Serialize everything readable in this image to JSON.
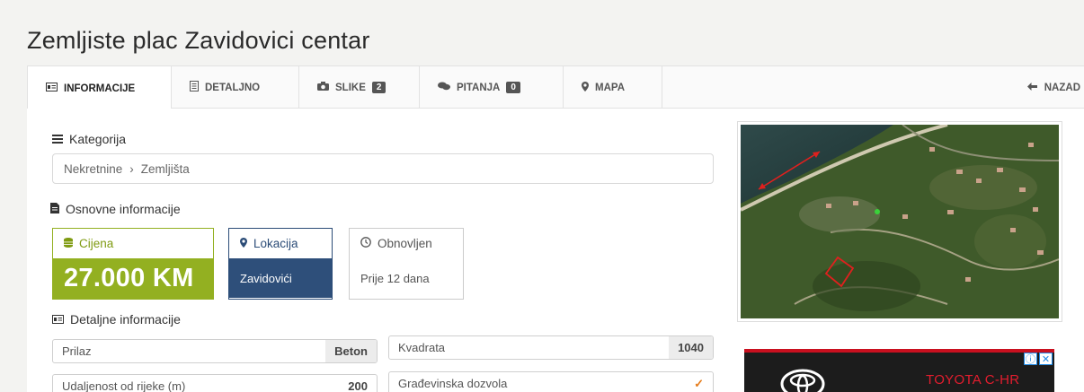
{
  "title": "Zemljiste plac Zavidovici centar",
  "tabs": [
    {
      "label": "INFORMACIJE",
      "icon": "id-card-icon",
      "active": true
    },
    {
      "label": "DETALJNO",
      "icon": "list-icon"
    },
    {
      "label": "SLIKE",
      "icon": "camera-icon",
      "count": "2"
    },
    {
      "label": "PITANJA",
      "icon": "comments-icon",
      "count": "0"
    },
    {
      "label": "MAPA",
      "icon": "map-pin-icon"
    }
  ],
  "back_label": "NAZAD",
  "kategorija": {
    "title": "Kategorija",
    "crumb_1": "Nekretnine",
    "crumb_sep": "›",
    "crumb_2": "Zemljišta"
  },
  "osnovne": {
    "title": "Osnovne informacije",
    "price": {
      "label": "Cijena",
      "value": "27.000 KM"
    },
    "location": {
      "label": "Lokacija",
      "value": "Zavidovići"
    },
    "updated": {
      "label": "Obnovljen",
      "value": "Prije 12 dana"
    }
  },
  "detaljne": {
    "title": "Detaljne informacije",
    "rows": [
      {
        "label": "Prilaz",
        "value": "Beton"
      },
      {
        "label": "Kvadrata",
        "value": "1040"
      },
      {
        "label": "Udaljenost od rijeke (m)",
        "value": "200"
      },
      {
        "label": "Građevinska dozvola",
        "value": "✓"
      }
    ]
  },
  "ad": {
    "text": "TOYOTA C-HR",
    "close_info": "ⓘ",
    "close_x": "✕"
  },
  "colors": {
    "price_green": "#93b021",
    "location_blue": "#2e4f7a",
    "ad_red": "#e31d2e"
  }
}
